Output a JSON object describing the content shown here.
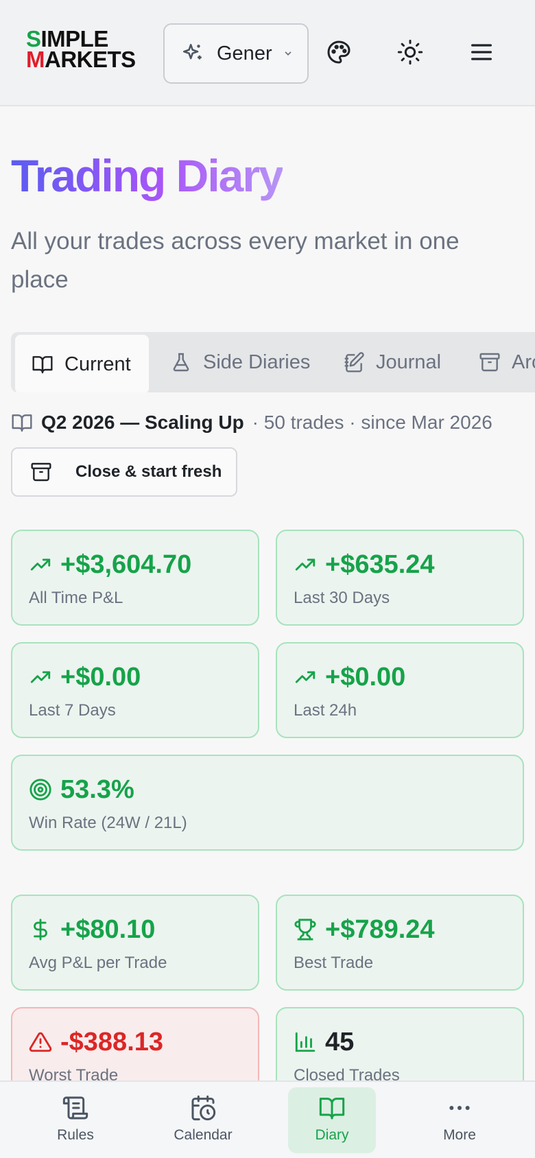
{
  "header": {
    "logo_line1_first": "S",
    "logo_line1_rest": "IMPLE",
    "logo_line2_first": "M",
    "logo_line2_rest": "ARKETS",
    "model_select": "Gener"
  },
  "page": {
    "title": "Trading Diary",
    "subtitle": "All your trades across every market in one place"
  },
  "tabs": [
    {
      "label": "Current",
      "active": true
    },
    {
      "label": "Side Diaries"
    },
    {
      "label": "Journal"
    },
    {
      "label": "Archive"
    }
  ],
  "diary": {
    "name": "Q2 2026 — Scaling Up",
    "meta": "· 50 trades · since Mar 2026",
    "close_button": "Close & start fresh"
  },
  "stats": {
    "all_time": {
      "value": "+$3,604.70",
      "label": "All Time P&L"
    },
    "last_30": {
      "value": "+$635.24",
      "label": "Last 30 Days"
    },
    "last_7": {
      "value": "+$0.00",
      "label": "Last 7 Days"
    },
    "last_24h": {
      "value": "+$0.00",
      "label": "Last 24h"
    },
    "win_rate": {
      "value": "53.3%",
      "label": "Win Rate (24W / 21L)"
    },
    "avg_pl": {
      "value": "+$80.10",
      "label": "Avg P&L per Trade"
    },
    "best": {
      "value": "+$789.24",
      "label": "Best Trade"
    },
    "worst": {
      "value": "-$388.13",
      "label": "Worst Trade"
    },
    "closed": {
      "value": "45",
      "label": "Closed Trades"
    }
  },
  "nav": [
    {
      "label": "Rules",
      "icon": "scroll-icon"
    },
    {
      "label": "Calendar",
      "icon": "calendar-clock-icon"
    },
    {
      "label": "Diary",
      "icon": "book-open-icon",
      "active": true
    },
    {
      "label": "More",
      "icon": "more-horizontal-icon"
    }
  ],
  "colors": {
    "positive": "#16a34a",
    "negative": "#dc2626",
    "accent_start": "#5b5cf0",
    "accent_end": "#a855f7"
  }
}
